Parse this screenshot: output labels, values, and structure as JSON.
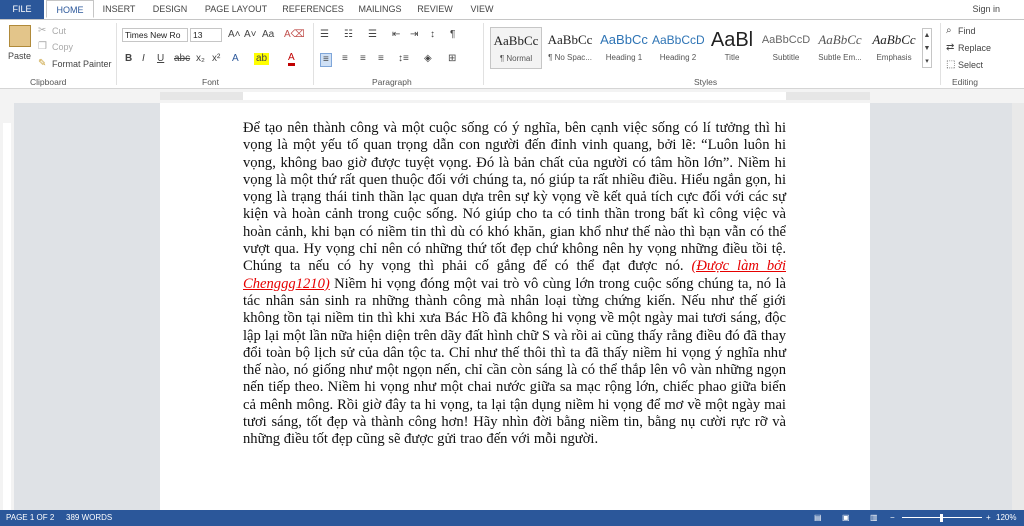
{
  "tabs": [
    "FILE",
    "HOME",
    "INSERT",
    "DESIGN",
    "PAGE LAYOUT",
    "REFERENCES",
    "MAILINGS",
    "REVIEW",
    "VIEW"
  ],
  "sign_in": "Sign in",
  "clipboard": {
    "paste": "Paste",
    "cut": "Cut",
    "copy": "Copy",
    "format_painter": "Format Painter",
    "label": "Clipboard"
  },
  "font": {
    "name": "Times New Ro",
    "size": "13",
    "label": "Font"
  },
  "paragraph": {
    "label": "Paragraph"
  },
  "styles": {
    "label": "Styles",
    "items": [
      {
        "preview": "AaBbCc",
        "name": "¶ Normal"
      },
      {
        "preview": "AaBbCc",
        "name": "¶ No Spac..."
      },
      {
        "preview": "AaBbCc",
        "name": "Heading 1"
      },
      {
        "preview": "AaBbCcD",
        "name": "Heading 2"
      },
      {
        "preview": "AaBl",
        "name": "Title"
      },
      {
        "preview": "AaBbCcD",
        "name": "Subtitle"
      },
      {
        "preview": "AaBbCc",
        "name": "Subtle Em..."
      },
      {
        "preview": "AaBbCc",
        "name": "Emphasis"
      }
    ]
  },
  "editing": {
    "find": "Find",
    "replace": "Replace",
    "select": "Select",
    "label": "Editing"
  },
  "document": {
    "text_before": "Để tạo nên thành công và một cuộc sống có ý nghĩa, bên cạnh việc sống có lí tưởng thì hi vọng là một yếu tố quan trọng dẫn con người đến đỉnh vinh quang, bởi lẽ: “Luôn luôn hi vọng, không bao giờ được tuyệt vọng. Đó là bản chất của người có tâm hồn lớn”. Niềm hi vọng là một thứ rất quen thuộc đối với chúng ta, nó giúp ta rất nhiều điều. Hiểu ngắn gọn, hi vọng là trạng thái tinh thần lạc quan dựa trên sự kỳ vọng về kết quả tích cực đối với các sự kiện và hoàn cảnh trong cuộc sống. Nó giúp cho ta có tinh thần trong bất kì công việc và hoàn cảnh, khi bạn có niềm tin thì dù có khó khăn, gian khổ như thế nào thì bạn vẫn có thể vượt qua. Hy vọng chỉ nên có những thứ tốt đẹp chứ không nên hy vọng những điều tồi tệ. Chúng ta nếu có hy vọng thì phải cố gắng để có thể đạt được nó. ",
    "credit": "(Được làm bởi Chenggg1210)",
    "text_after": " Niềm hi vọng đóng một vai trò vô cùng lớn trong cuộc sống chúng ta, nó là tác nhân sản sinh ra những thành công mà nhân loại từng chứng kiến. Nếu như thế giới không tồn tại niềm tin thì khi xưa Bác Hồ đã không hi vọng về một ngày mai tươi sáng, độc lập lại một lần nữa hiện diện trên dãy đất hình chữ S và rồi ai cũng thấy rằng điều đó đã thay đổi toàn bộ lịch sử của dân tộc ta. Chỉ như thế thôi thì ta đã thấy niềm hi vọng ý nghĩa như thế nào, nó giống như một ngọn nến, chỉ cần còn sáng là có thể thắp lên vô vàn những ngọn nến tiếp theo. Niềm hi vọng như một chai nước giữa sa mạc rộng lớn, chiếc phao giữa biển cả mênh mông. Rồi giờ đây ta hi vọng, ta lại tận dụng niềm hi vọng để mơ về một ngày mai tươi sáng, tốt đẹp và thành công hơn! Hãy nhìn đời bằng niềm tin, bằng nụ cười rực rỡ và những điều tốt đẹp cũng sẽ được gửi trao đến với mỗi người."
  },
  "status": {
    "page": "PAGE 1 OF 2",
    "words": "389 WORDS",
    "zoom": "120%"
  }
}
